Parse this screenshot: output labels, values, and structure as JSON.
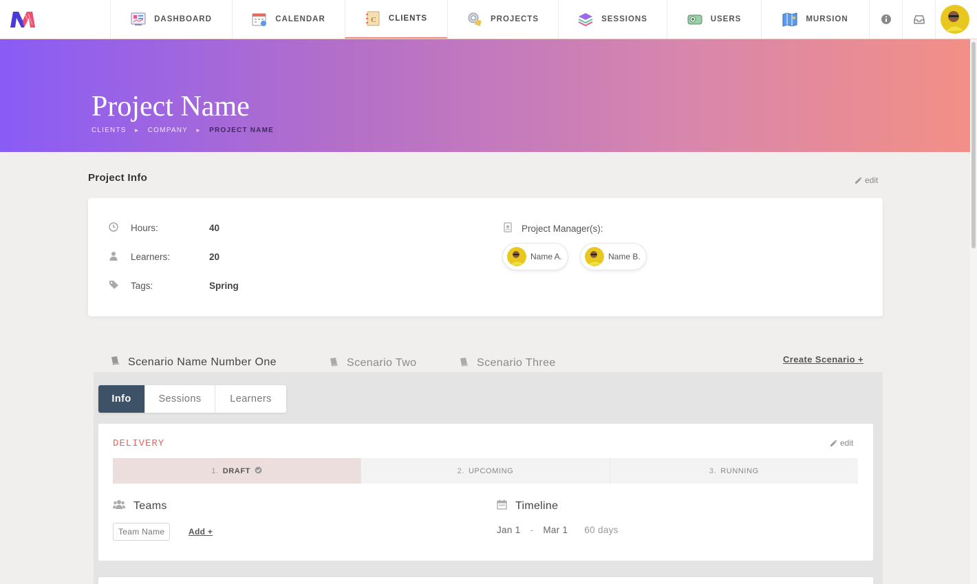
{
  "nav": {
    "items": [
      {
        "label": "DASHBOARD",
        "icon": "dashboard-icon"
      },
      {
        "label": "CALENDAR",
        "icon": "calendar-icon"
      },
      {
        "label": "CLIENTS",
        "icon": "clients-icon",
        "active": true
      },
      {
        "label": "PROJECTS",
        "icon": "projects-icon"
      },
      {
        "label": "SESSIONS",
        "icon": "sessions-icon"
      },
      {
        "label": "USERS",
        "icon": "users-icon"
      },
      {
        "label": "MURSION",
        "icon": "mursion-icon"
      }
    ],
    "utilities": [
      "info-icon",
      "inbox-icon"
    ]
  },
  "hero": {
    "title": "Project Name",
    "breadcrumb": [
      "CLIENTS",
      "COMPANY",
      "PROJECT NAME"
    ]
  },
  "project_info": {
    "title": "Project Info",
    "edit_label": "edit",
    "hours_label": "Hours:",
    "hours_value": "40",
    "learners_label": "Learners:",
    "learners_value": "20",
    "tags_label": "Tags:",
    "tags_value": "Spring",
    "managers_label": "Project Manager(s):",
    "managers": [
      "Name A.",
      "Name B."
    ]
  },
  "scenarios": {
    "tabs": [
      "Scenario Name Number One",
      "Scenario Two",
      "Scenario Three"
    ],
    "active_index": 0,
    "create_label": "Create Scenario +"
  },
  "subtabs": [
    "Info",
    "Sessions",
    "Learners"
  ],
  "delivery": {
    "title": "DELIVERY",
    "edit_label": "edit",
    "stages": [
      {
        "num": "1.",
        "name": "DRAFT",
        "active": true
      },
      {
        "num": "2.",
        "name": "UPCOMING",
        "active": false
      },
      {
        "num": "3.",
        "name": "RUNNING",
        "active": false
      }
    ],
    "teams_heading": "Teams",
    "team_name": "Team Name",
    "add_label": "Add +",
    "timeline_heading": "Timeline",
    "timeline_start": "Jan 1",
    "timeline_sep": "-",
    "timeline_end": "Mar 1",
    "timeline_days": "60 days"
  },
  "colors": {
    "accent_red": "#e8645a",
    "active_subtab": "#3d5266",
    "tab_underline": "#9d87f0",
    "gradient_start": "#8a5cf6",
    "gradient_end": "#f38f86"
  }
}
